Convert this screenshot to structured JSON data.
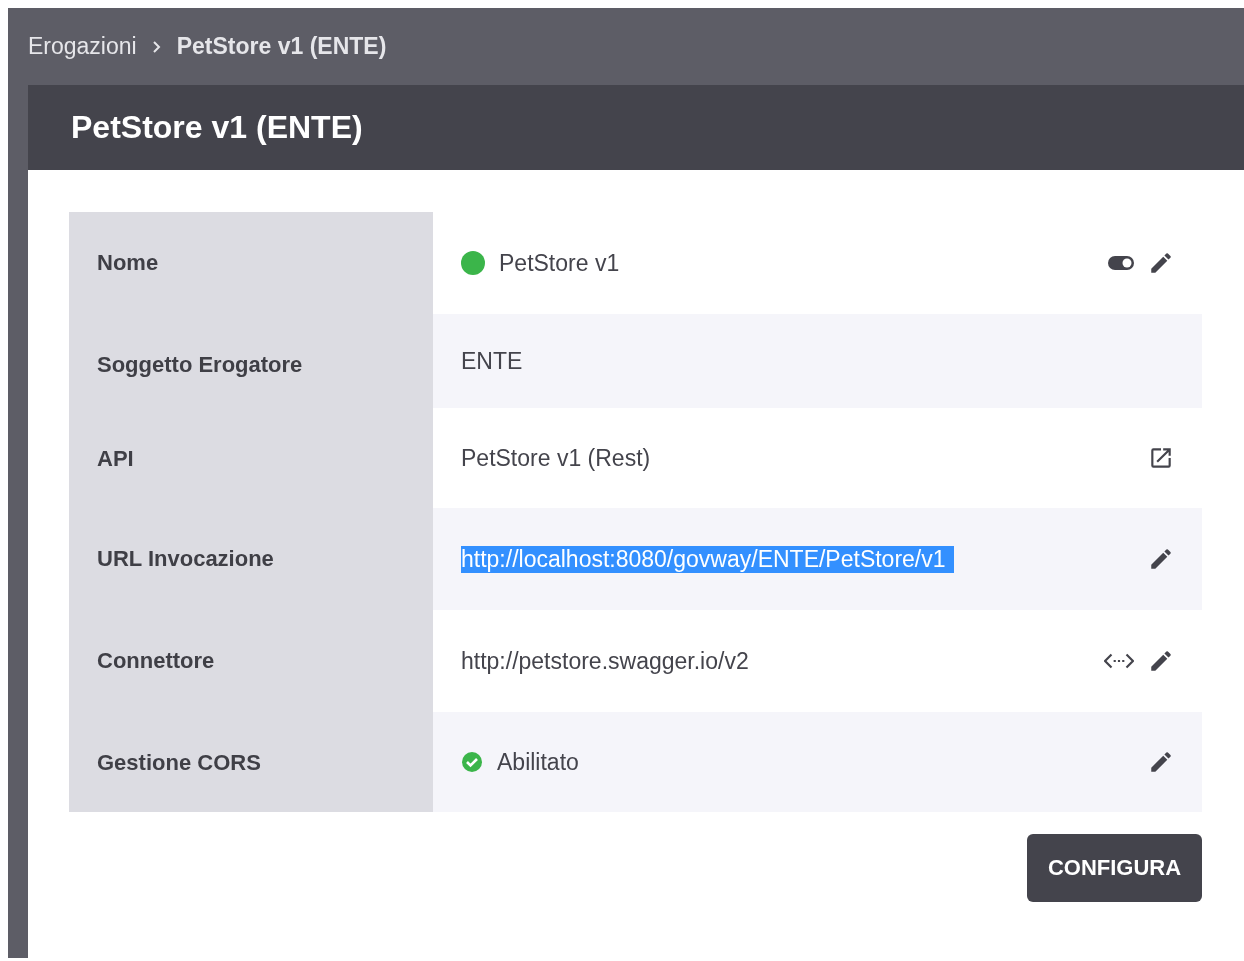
{
  "breadcrumb": [
    {
      "label": "Erogazioni",
      "current": false
    },
    {
      "label": "PetStore v1 (ENTE)",
      "current": true
    }
  ],
  "title": "PetStore v1 (ENTE)",
  "rows": [
    {
      "label": "Nome",
      "value": "PetStore v1",
      "highlighted": false,
      "status": {
        "kind": "dot",
        "color": "#3bb54a"
      },
      "toggle": true,
      "external_link": false,
      "connector_link": false,
      "editable": true
    },
    {
      "label": "Soggetto Erogatore",
      "value": "ENTE",
      "highlighted": false,
      "toggle": false,
      "external_link": false,
      "connector_link": false,
      "editable": false
    },
    {
      "label": "API",
      "value": "PetStore v1 (Rest)",
      "highlighted": false,
      "toggle": false,
      "external_link": true,
      "connector_link": false,
      "editable": false
    },
    {
      "label": "URL Invocazione",
      "value": "http://localhost:8080/govway/ENTE/PetStore/v1",
      "highlighted": true,
      "toggle": false,
      "external_link": false,
      "connector_link": false,
      "editable": true
    },
    {
      "label": "Connettore",
      "value": "http://petstore.swagger.io/v2",
      "highlighted": false,
      "toggle": false,
      "external_link": false,
      "connector_link": true,
      "editable": true
    },
    {
      "label": "Gestione CORS",
      "value": "Abilitato",
      "highlighted": false,
      "status": {
        "kind": "check",
        "color": "#3bb54a"
      },
      "toggle": false,
      "external_link": false,
      "connector_link": false,
      "editable": true
    }
  ],
  "button": "CONFIGURA"
}
